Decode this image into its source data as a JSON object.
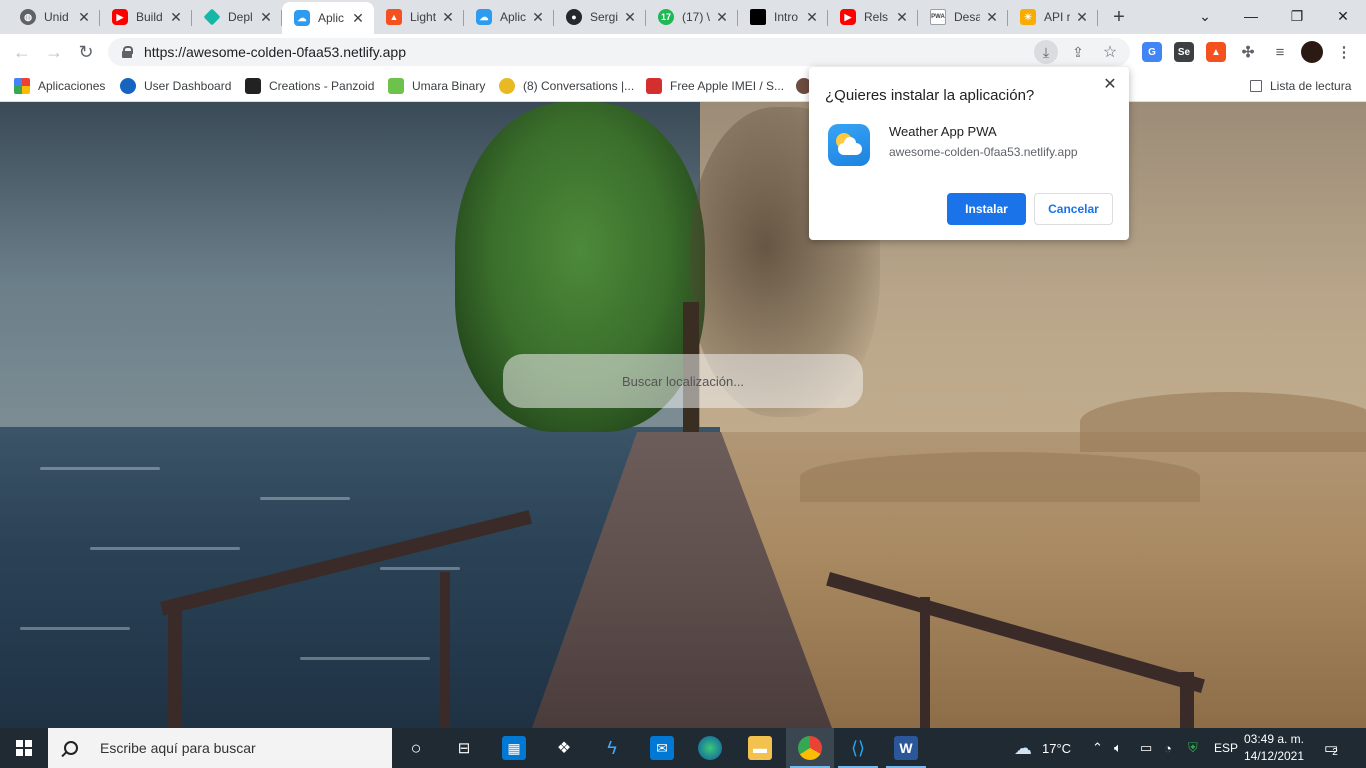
{
  "tabs": [
    {
      "title": "Unid",
      "favicon_color": "#5f6368",
      "favicon": "globe-icon"
    },
    {
      "title": "Build",
      "favicon_color": "#ff0000",
      "favicon": "youtube-icon"
    },
    {
      "title": "Depl",
      "favicon_color": "#15b8a6",
      "favicon": "diamond-icon"
    },
    {
      "title": "Aplic",
      "favicon_color": "#2d9cf0",
      "favicon": "weather-icon",
      "active": true
    },
    {
      "title": "Light",
      "favicon_color": "#f4511e",
      "favicon": "lighthouse-icon"
    },
    {
      "title": "Aplic",
      "favicon_color": "#2d9cf0",
      "favicon": "weather-icon"
    },
    {
      "title": "Sergi",
      "favicon_color": "#24292e",
      "favicon": "github-icon"
    },
    {
      "title": "(17) \\",
      "favicon_color": "#1db954",
      "favicon": "badge-icon",
      "badge": "17"
    },
    {
      "title": "Intro",
      "favicon_color": "#000000",
      "favicon": "square-icon"
    },
    {
      "title": "Rels",
      "favicon_color": "#ff0000",
      "favicon": "youtube-icon"
    },
    {
      "title": "Desa",
      "favicon_color": "#3c4043",
      "favicon": "pwa-icon",
      "badge": "PWA"
    },
    {
      "title": "API r",
      "favicon_color": "#f9ab00",
      "favicon": "sun-icon"
    }
  ],
  "toolbar": {
    "url": "https://awesome-colden-0faa53.netlify.app"
  },
  "bookmarks": [
    {
      "label": "Aplicaciones",
      "icon": "apps-grid-icon",
      "color": "#ea4335"
    },
    {
      "label": "User Dashboard",
      "icon": "dashboard-icon",
      "color": "#1565c0"
    },
    {
      "label": "Creations - Panzoid",
      "icon": "panzoid-icon",
      "color": "#222222"
    },
    {
      "label": "Umara Binary",
      "icon": "umara-icon",
      "color": "#6cc24a"
    },
    {
      "label": "(8) Conversations |...",
      "icon": "conversations-icon",
      "color": "#e8b923"
    },
    {
      "label": "Free Apple IMEI / S...",
      "icon": "apple-imei-icon",
      "color": "#d32f2f"
    },
    {
      "label": "",
      "icon": "cookie-icon",
      "color": "#6d4c41"
    }
  ],
  "reading_list": "Lista de lectura",
  "search": {
    "placeholder": "Buscar localización..."
  },
  "install_dialog": {
    "title": "¿Quieres instalar la aplicación?",
    "app_name": "Weather App PWA",
    "app_origin": "awesome-colden-0faa53.netlify.app",
    "install_label": "Instalar",
    "cancel_label": "Cancelar"
  },
  "taskbar": {
    "search_placeholder": "Escribe aquí para buscar",
    "weather": "17°C",
    "language": "ESP",
    "time": "03:49 a. m.",
    "date": "14/12/2021",
    "notifications": "2"
  },
  "colors": {
    "accent": "#1a73e8",
    "taskbar": "#1f2a33"
  }
}
